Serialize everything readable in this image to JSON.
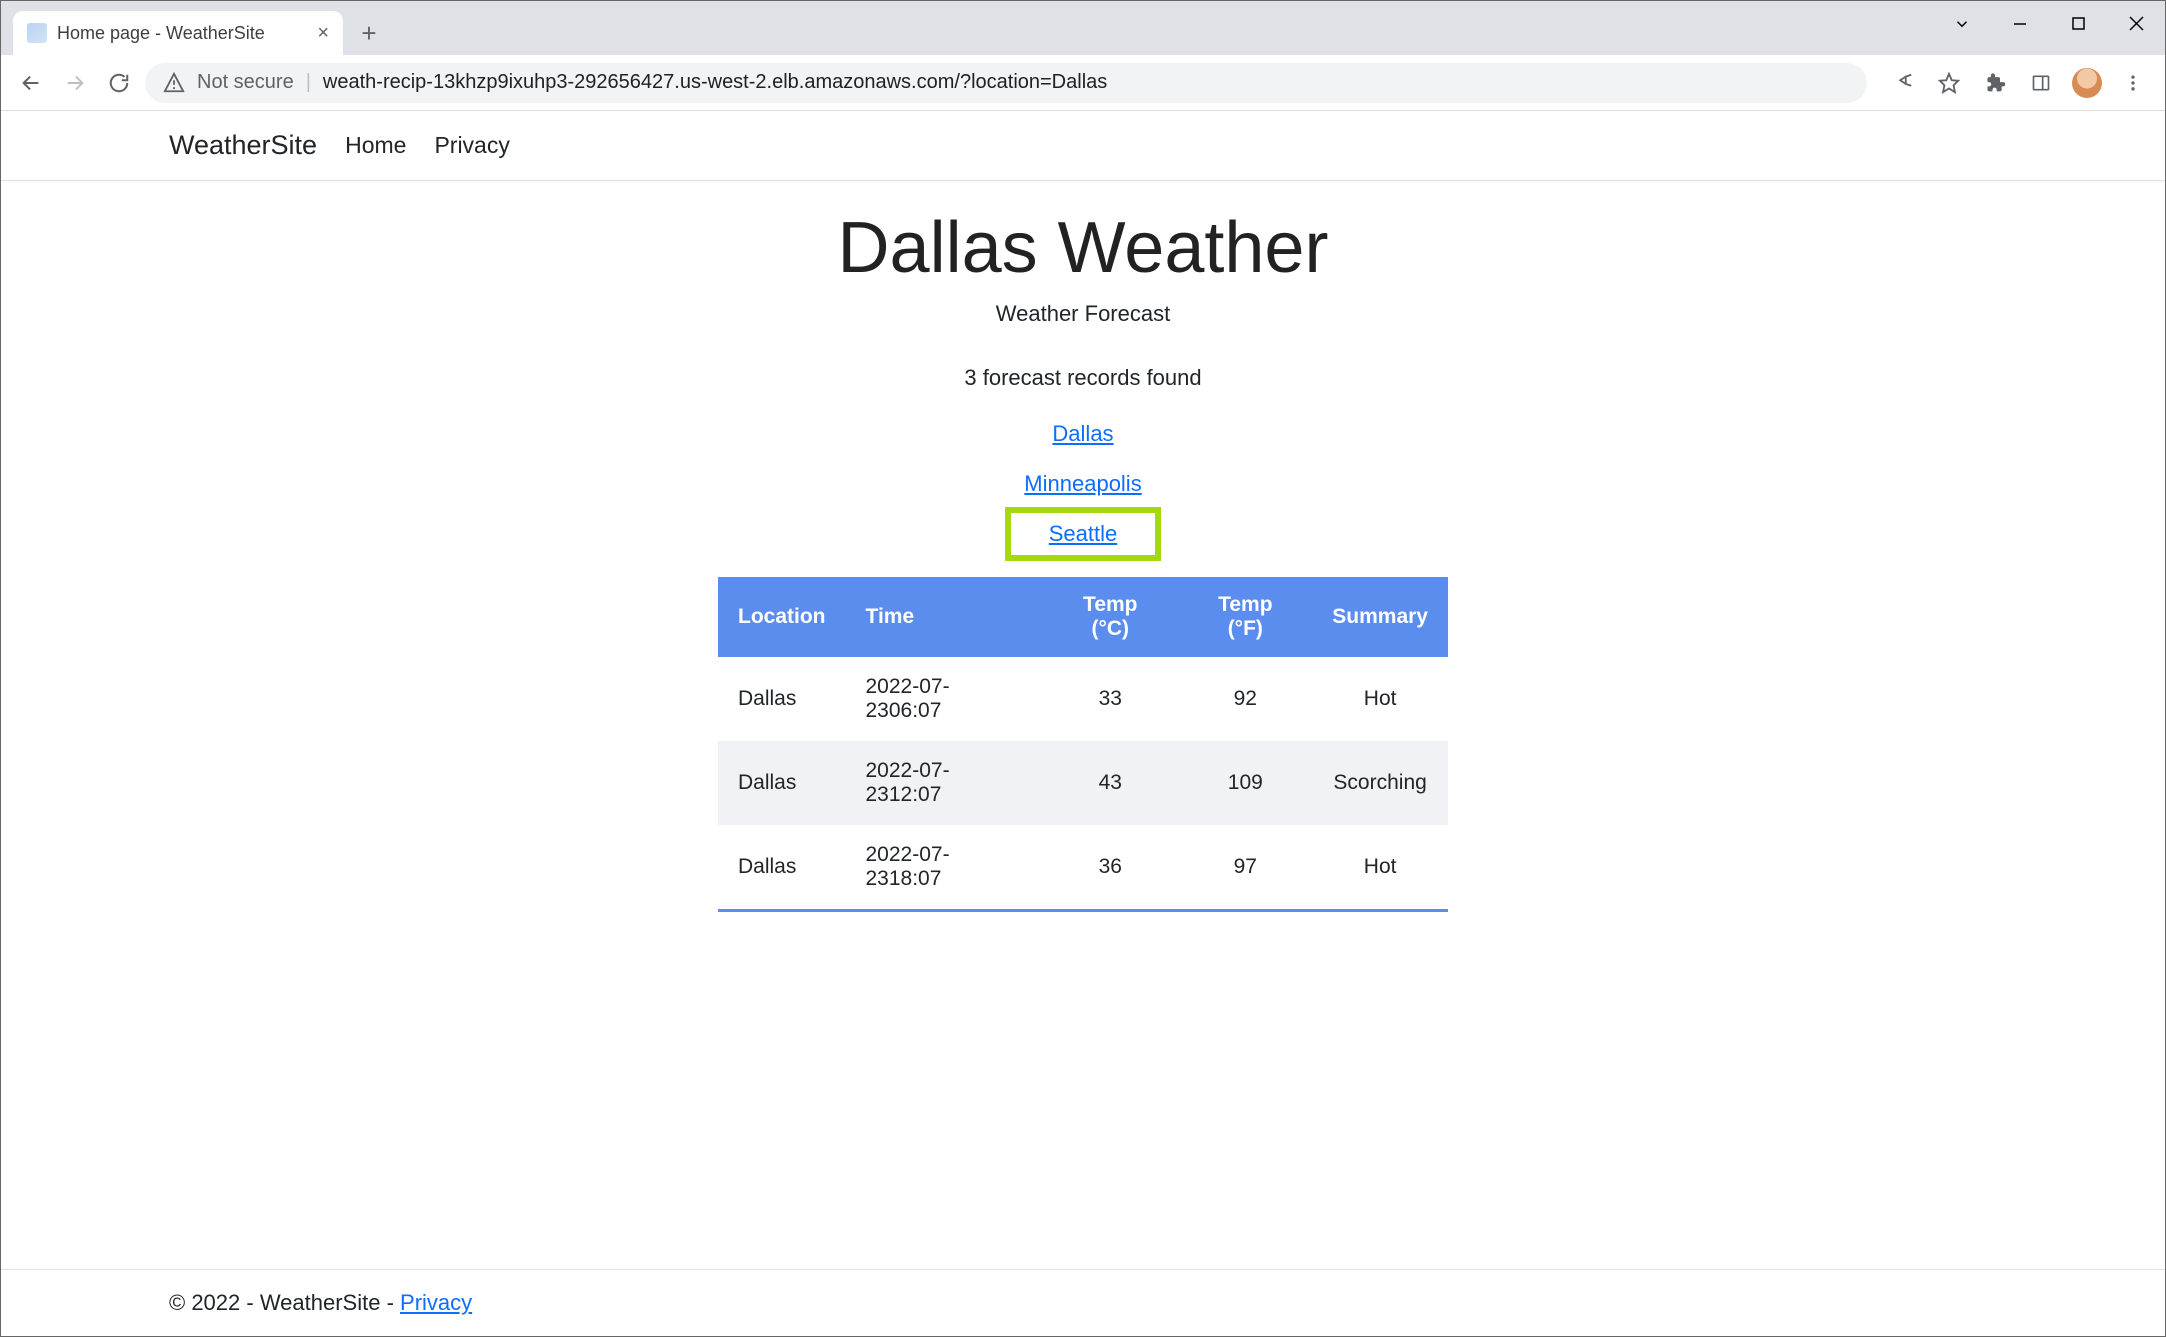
{
  "browser": {
    "tab_title": "Home page - WeatherSite",
    "not_secure_label": "Not secure",
    "url": "weath-recip-13khzp9ixuhp3-292656427.us-west-2.elb.amazonaws.com/?location=Dallas"
  },
  "navbar": {
    "brand": "WeatherSite",
    "links": {
      "home": "Home",
      "privacy": "Privacy"
    }
  },
  "header": {
    "title": "Dallas Weather",
    "subtitle": "Weather Forecast",
    "records_found": "3 forecast records found"
  },
  "city_links": {
    "dallas": "Dallas",
    "minneapolis": "Minneapolis",
    "seattle": "Seattle"
  },
  "table": {
    "headers": {
      "location": "Location",
      "time": "Time",
      "temp_c": "Temp (°C)",
      "temp_f": "Temp (°F)",
      "summary": "Summary"
    },
    "rows": [
      {
        "location": "Dallas",
        "time": "2022-07-2306:07",
        "temp_c": "33",
        "temp_f": "92",
        "summary": "Hot"
      },
      {
        "location": "Dallas",
        "time": "2022-07-2312:07",
        "temp_c": "43",
        "temp_f": "109",
        "summary": "Scorching"
      },
      {
        "location": "Dallas",
        "time": "2022-07-2318:07",
        "temp_c": "36",
        "temp_f": "97",
        "summary": "Hot"
      }
    ]
  },
  "footer": {
    "text": "© 2022 - WeatherSite - ",
    "privacy": "Privacy"
  }
}
